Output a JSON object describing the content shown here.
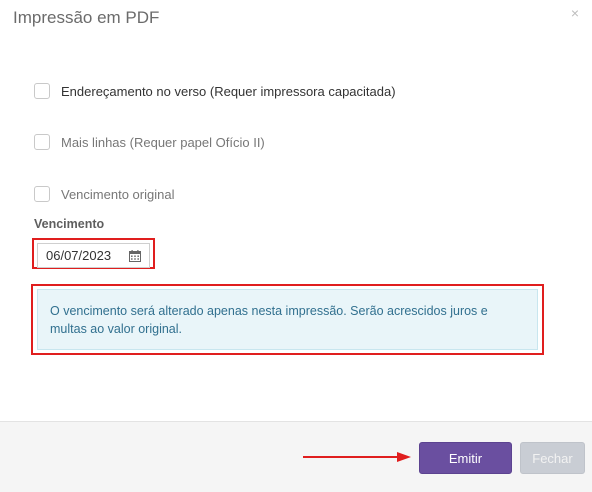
{
  "dialog": {
    "title": "Impressão em PDF",
    "close_symbol": "×"
  },
  "options": [
    {
      "label": "Endereçamento no verso (Requer impressora capacitada)",
      "checked": false
    },
    {
      "label": "Mais linhas (Requer papel Ofício II)",
      "checked": false
    },
    {
      "label": "Vencimento original",
      "checked": false
    }
  ],
  "due_date": {
    "label": "Vencimento",
    "value": "06/07/2023",
    "icon": "calendar-icon"
  },
  "info_alert": {
    "text": "O vencimento será alterado apenas nesta impressão. Serão acrescidos juros e multas ao valor original."
  },
  "footer": {
    "emit_label": "Emitir",
    "close_label": "Fechar"
  },
  "colors": {
    "primary": "#6a4fa0",
    "highlight": "#e01e1e",
    "alert_bg": "#e9f5f9",
    "alert_text": "#31708f"
  }
}
